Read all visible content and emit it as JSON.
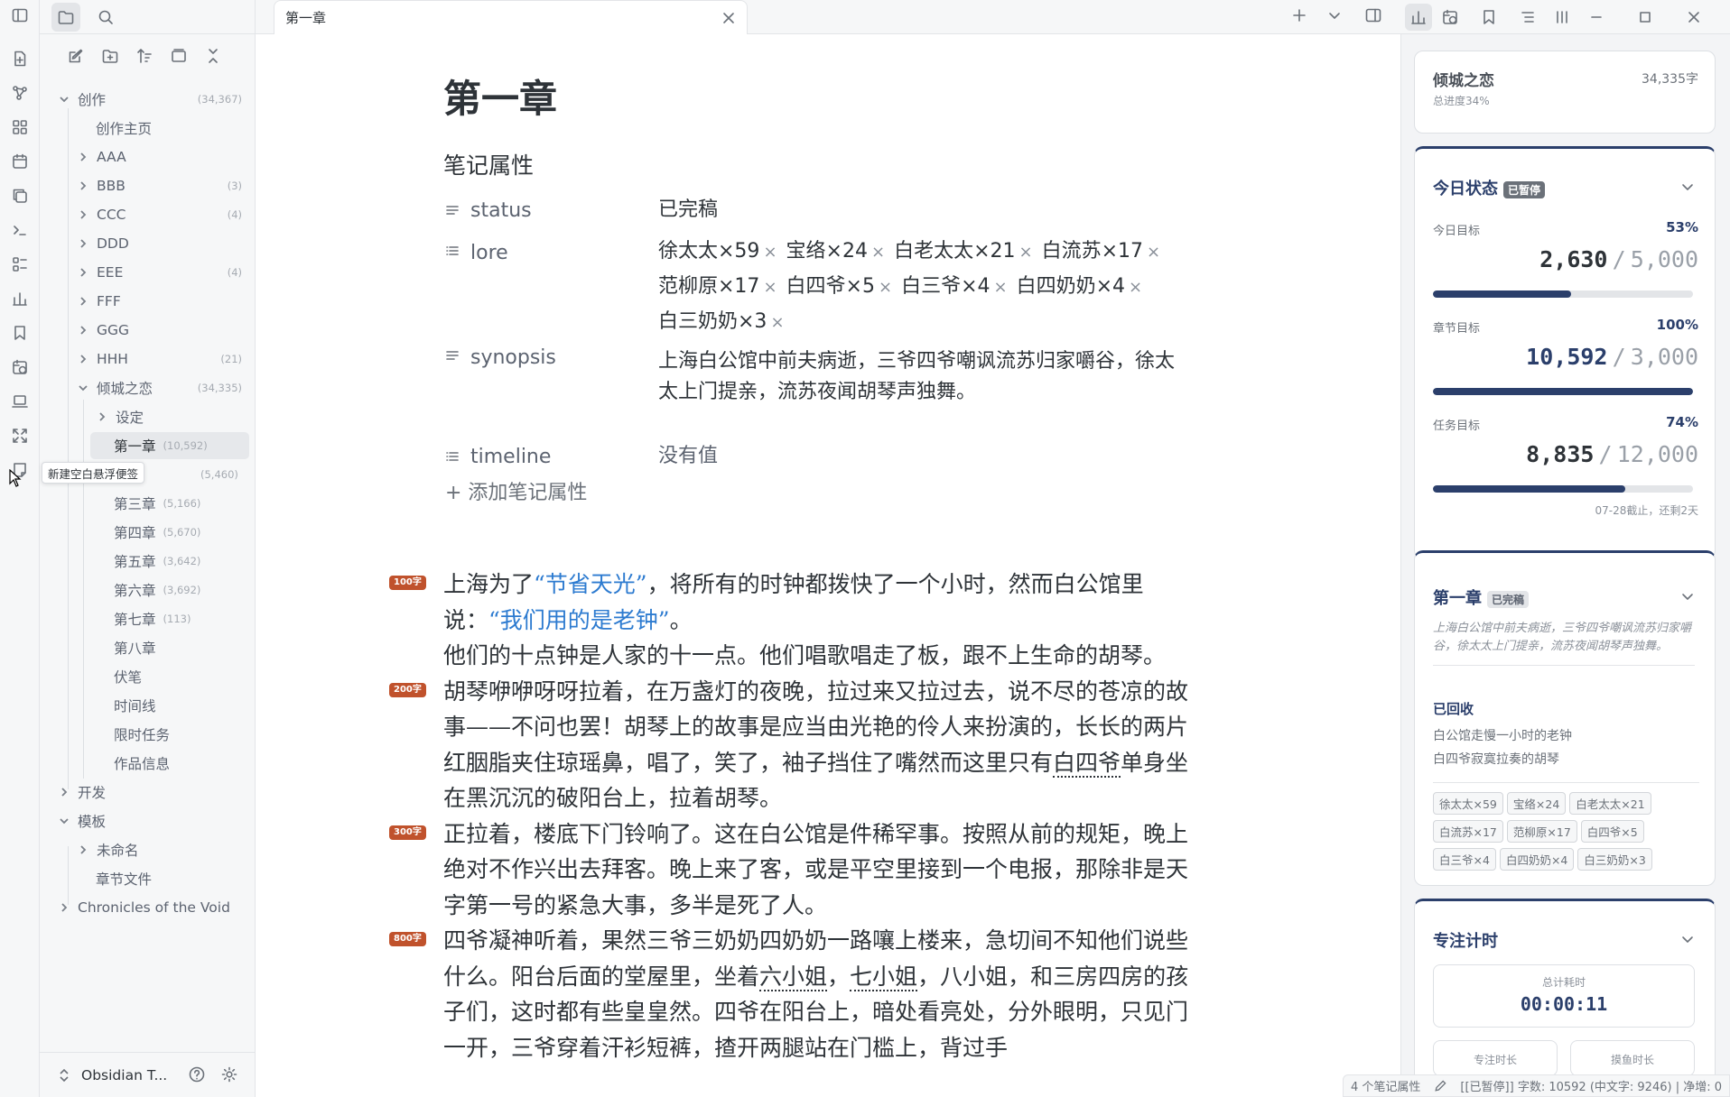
{
  "sidebar": {
    "tree": [
      {
        "label": "创作",
        "count": "(34,367)"
      },
      {
        "label": "创作主页"
      },
      {
        "label": "AAA"
      },
      {
        "label": "BBB",
        "count": "(3)"
      },
      {
        "label": "CCC",
        "count": "(4)"
      },
      {
        "label": "DDD"
      },
      {
        "label": "EEE",
        "count": "(4)"
      },
      {
        "label": "FFF"
      },
      {
        "label": "GGG"
      },
      {
        "label": "HHH",
        "count": "(21)"
      },
      {
        "label": "倾城之恋",
        "count": "(34,335)"
      },
      {
        "label": "设定"
      },
      {
        "label": "第一章",
        "count": "(10,592)"
      },
      {
        "label": "",
        "count": "(5,460)"
      },
      {
        "label": "第三章",
        "count": "(5,166)"
      },
      {
        "label": "第四章",
        "count": "(5,670)"
      },
      {
        "label": "第五章",
        "count": "(3,642)"
      },
      {
        "label": "第六章",
        "count": "(3,692)"
      },
      {
        "label": "第七章",
        "count": "(113)"
      },
      {
        "label": "第八章"
      },
      {
        "label": "伏笔"
      },
      {
        "label": "时间线"
      },
      {
        "label": "限时任务"
      },
      {
        "label": "作品信息"
      },
      {
        "label": "开发"
      },
      {
        "label": "模板"
      },
      {
        "label": "未命名"
      },
      {
        "label": "章节文件"
      },
      {
        "label": "Chronicles of the Void"
      }
    ],
    "tooltip": "新建空白悬浮便签",
    "vault_name": "Obsidian T..."
  },
  "tabs": {
    "active": "第一章"
  },
  "note": {
    "title": "第一章",
    "properties_heading": "笔记属性",
    "properties": {
      "status": {
        "key": "status",
        "value": "已完稿"
      },
      "lore": {
        "key": "lore",
        "items": [
          "徐太太×59",
          "宝络×24",
          "白老太太×21",
          "白流苏×17",
          "范柳原×17",
          "白四爷×5",
          "白三爷×4",
          "白四奶奶×4",
          "白三奶奶×3"
        ],
        "remove": "×"
      },
      "synopsis": {
        "key": "synopsis",
        "value": "上海白公馆中前夫病逝，三爷四爷嘲讽流苏归家嚼谷，徐太太上门提亲，流苏夜闻胡琴声独舞。"
      },
      "timeline": {
        "key": "timeline",
        "value": "没有值"
      }
    },
    "add_property": "+ 添加笔记属性",
    "badges": [
      "100字",
      "200字",
      "300字",
      "800字"
    ],
    "p1": {
      "a": "上海为了",
      "q1": "“节省天光”",
      "b": "，将所有的时钟都拨快了一个小时，然而白公馆里说：",
      "q2": "“我们用的是老钟”",
      "c": "。"
    },
    "p2": "他们的十点钟是人家的十一点。他们唱歌唱走了板，跟不上生命的胡琴。",
    "p3": {
      "a": "胡琴咿咿呀呀拉着，在万盏灯的夜晚，拉过来又拉过去，说不尽的苍凉的故事——不问也罢！胡琴上的故事是应当由光艳的伶人来扮演的，长长的两片红胭脂夹住琼瑶鼻，唱了，笑了，袖子挡住了嘴然而这里只有",
      "u": "白四爷",
      "b": "单身坐在黑沉沉的破阳台上，拉着胡琴。"
    },
    "p4": "正拉着，楼底下门铃响了。这在白公馆是件稀罕事。按照从前的规矩，晚上绝对不作兴出去拜客。晚上来了客，或是平空里接到一个电报，那除非是天字第一号的紧急大事，多半是死了人。",
    "p5": {
      "a": "四爷凝神听着，果然三爷三奶奶四奶奶一路嚷上楼来，急切间不知他们说些什么。阳台后面的堂屋里，坐着",
      "u1": "六小姐",
      "s1": "，",
      "u2": "七小姐",
      "b": "，八小姐，和三房四房的孩子们，这时都有些皇皇然。四爷在阳台上，暗处看亮处，分外眼明，只见门一开，三爷穿着汗衫短裤，揸开两腿站在门槛上，背过手"
    }
  },
  "right": {
    "book": {
      "title": "倾城之恋",
      "words": "34,335字",
      "progress": "总进度34%"
    },
    "today": {
      "title": "今日状态",
      "badge": "已暂停",
      "goals": [
        {
          "label": "今日目标",
          "pct": "53%",
          "value": "2,630",
          "target": "5,000",
          "fill": 0.53
        },
        {
          "label": "章节目标",
          "pct": "100%",
          "value": "10,592",
          "target": "3,000",
          "fill": 1.0
        },
        {
          "label": "任务目标",
          "pct": "74%",
          "value": "8,835",
          "target": "12,000",
          "fill": 0.74
        }
      ],
      "slash": "/",
      "deadline": "07-28截止，还剩2天"
    },
    "chapter": {
      "title": "第一章",
      "badge": "已完稿",
      "summary": "上海白公馆中前夫病逝，三爷四爷嘲讽流苏归家嚼谷，徐太太上门提亲，流苏夜闻胡琴声独舞。",
      "recycled_heading": "已回收",
      "recycled": [
        "白公馆走慢一小时的老钟",
        "白四爷寂寞拉奏的胡琴"
      ],
      "chips": [
        "徐太太×59",
        "宝络×24",
        "白老太太×21",
        "白流苏×17",
        "范柳原×17",
        "白四爷×5",
        "白三爷×4",
        "白四奶奶×4",
        "白三奶奶×3"
      ]
    },
    "focus": {
      "title": "专注计时",
      "total_label": "总计耗时",
      "total": "00:00:11",
      "focus_label": "专注时长",
      "slack_label": "摸鱼时长"
    }
  },
  "statusbar": {
    "props": "4 个笔记属性",
    "counts": "[[已暂停]] 字数: 10592 (中文字: 9246) | 净增: 0"
  }
}
